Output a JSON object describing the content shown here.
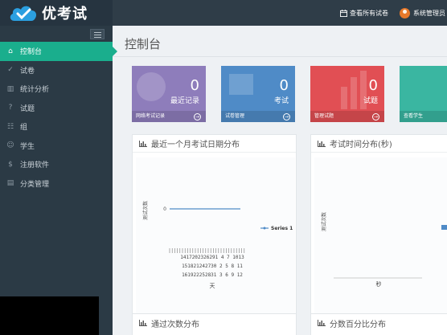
{
  "brand": {
    "name": "优考试"
  },
  "topbar": {
    "view_all_label": "查看所有试卷",
    "user_label": "系统管理员"
  },
  "sidebar": {
    "items": [
      {
        "label": "控制台",
        "icon": "home-icon",
        "active": true
      },
      {
        "label": "试卷",
        "icon": "check-circle-icon"
      },
      {
        "label": "统计分析",
        "icon": "bar-chart-icon"
      },
      {
        "label": "试题",
        "icon": "question-circle-icon"
      },
      {
        "label": "组",
        "icon": "group-icon"
      },
      {
        "label": "学生",
        "icon": "user-icon"
      },
      {
        "label": "注册软件",
        "icon": "dollar-icon"
      },
      {
        "label": "分类管理",
        "icon": "folder-icon"
      }
    ]
  },
  "main": {
    "title": "控制台",
    "tiles": [
      {
        "value": "0",
        "label": "最近记录",
        "footer": "网络考试记录",
        "color": "#8e7dbb"
      },
      {
        "value": "0",
        "label": "考试",
        "footer": "试卷管理",
        "color": "#4f8bc7"
      },
      {
        "value": "0",
        "label": "试题",
        "footer": "管理试题",
        "color": "#e14f54"
      },
      {
        "value": "",
        "label": "",
        "footer": "查看学生",
        "color": "#3ab6a1"
      }
    ],
    "panels": {
      "monthly_title": "最近一个月考试日期分布",
      "duration_title": "考试时间分布(秒)",
      "pass_title": "通过次数分布",
      "score_title": "分数百分比分布"
    }
  },
  "chart_data": [
    {
      "type": "line",
      "title": "最近一个月考试日期分布",
      "xlabel": "天",
      "ylabel": "测试次数",
      "tick_rows": [
        "1417202326291 4 7 1013",
        "151821242730 2 5 8 11",
        "161922252831 3 6 9 12"
      ],
      "series": [
        {
          "name": "Series 1",
          "values": [
            0
          ]
        }
      ],
      "y_tick": "0",
      "legend": "right"
    },
    {
      "type": "bar",
      "title": "考试时间分布(秒)",
      "xlabel": "秒",
      "ylabel": "测试次数"
    }
  ]
}
